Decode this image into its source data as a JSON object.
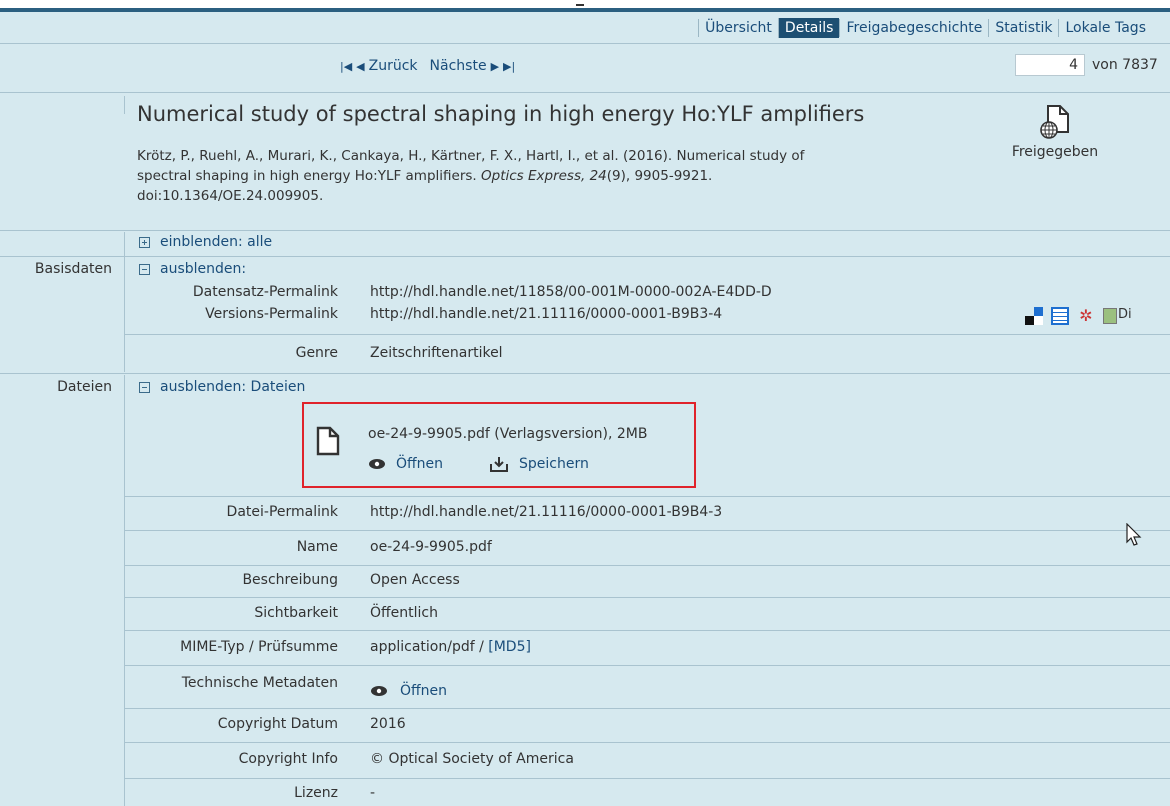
{
  "tabs": [
    {
      "label": "Übersicht",
      "active": false
    },
    {
      "label": "Details",
      "active": true
    },
    {
      "label": "Freigabegeschichte",
      "active": false
    },
    {
      "label": "Statistik",
      "active": false
    },
    {
      "label": "Lokale Tags",
      "active": false
    }
  ],
  "pager": {
    "prev": "Zurück",
    "next": "Nächste",
    "current": "4",
    "total": "von 7837"
  },
  "record": {
    "title": "Numerical study of spectral shaping in high energy Ho:YLF amplifiers",
    "citation_line1": "Krötz, P., Ruehl, A., Murari, K., Cankaya, H., Kärtner, F. X., Hartl, I., et al. (2016). Numerical study of",
    "citation_line2_pre": "spectral shaping in high energy Ho:YLF amplifiers. ",
    "citation_journal": "Optics Express, 24",
    "citation_line2_post": "(9), 9905-9921.",
    "citation_line3": "doi:10.1364/OE.24.009905.",
    "status": "Freigegeben"
  },
  "expand_all": "einblenden: alle",
  "basis": {
    "section_label": "Basisdaten",
    "toggle": "ausblenden:",
    "permalink_label": "Datensatz-Permalink",
    "permalink_value": "http://hdl.handle.net/11858/00-001M-0000-002A-E4DD-D",
    "version_label": "Versions-Permalink",
    "version_value": "http://hdl.handle.net/21.11116/0000-0001-B9B3-4",
    "genre_label": "Genre",
    "genre_value": "Zeitschriftenartikel",
    "export_alt": "Di"
  },
  "files": {
    "section_label": "Dateien",
    "toggle": "ausblenden: Dateien",
    "file_name": "oe-24-9-9905.pdf (Verlagsversion), 2MB",
    "open": "Öffnen",
    "save": "Speichern",
    "rows": [
      {
        "label": "Datei-Permalink",
        "value": "http://hdl.handle.net/21.11116/0000-0001-B9B4-3"
      },
      {
        "label": "Name",
        "value": "oe-24-9-9905.pdf"
      },
      {
        "label": "Beschreibung",
        "value": "Open Access"
      },
      {
        "label": "Sichtbarkeit",
        "value": "Öffentlich"
      },
      {
        "label": "MIME-Typ / Prüfsumme",
        "value": "application/pdf / ",
        "link": "[MD5]"
      },
      {
        "label": "Technische Metadaten",
        "value": "Öffnen"
      },
      {
        "label": "Copyright Datum",
        "value": "2016"
      },
      {
        "label": "Copyright Info",
        "value": "© Optical Society of America"
      },
      {
        "label": "Lizenz",
        "value": "-"
      }
    ]
  }
}
